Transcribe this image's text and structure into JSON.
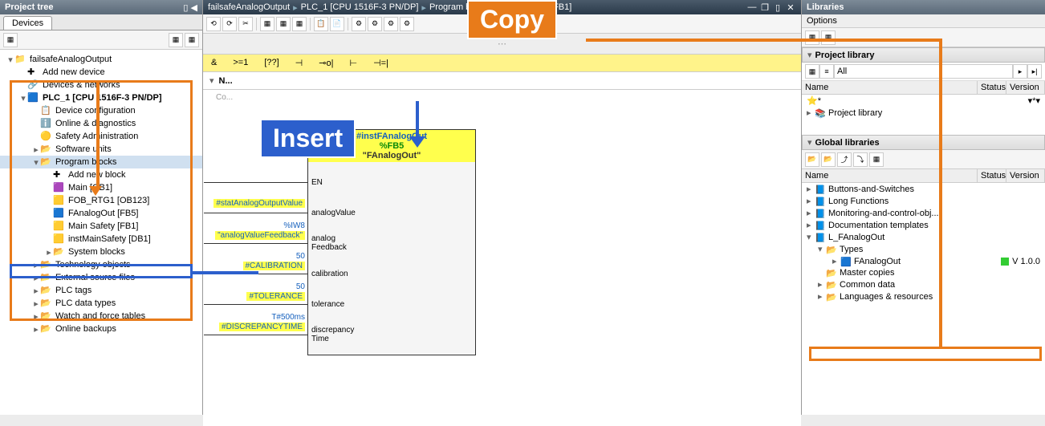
{
  "overlays": {
    "copy": "Copy",
    "insert": "Insert"
  },
  "left": {
    "header": "Project tree",
    "tab": "Devices",
    "tree": {
      "project": "failsafeAnalogOutput",
      "add_device": "Add new device",
      "devices_networks": "Devices & networks",
      "plc": "PLC_1 [CPU 1516F-3 PN/DP]",
      "device_config": "Device configuration",
      "online_diag": "Online & diagnostics",
      "safety_admin": "Safety Administration",
      "software_units": "Software units",
      "program_blocks": "Program blocks",
      "add_block": "Add new block",
      "main_ob1": "Main [OB1]",
      "fob_rtg1": "FOB_RTG1 [OB123]",
      "fanalogout": "FAnalogOut [FB5]",
      "main_safety": "Main Safety [FB1]",
      "inst_main_safety": "instMainSafety [DB1]",
      "system_blocks": "System blocks",
      "tech_objects": "Technology objects",
      "ext_source": "External source files",
      "plc_tags": "PLC tags",
      "plc_data_types": "PLC data types",
      "watch_tables": "Watch and force tables",
      "online_backups": "Online backups"
    }
  },
  "center": {
    "breadcrumb": [
      "failsafeAnalogOutput",
      "PLC_1 [CPU 1516F-3 PN/DP]",
      "Program blocks",
      "Main Safety [FB1]"
    ],
    "ladder_ops": [
      "&",
      ">=1",
      "[??]",
      "⊣",
      "⊸o|",
      "⊢",
      "⊣=|"
    ],
    "fb": {
      "inst": "#instFAnalogOut",
      "num": "%FB5",
      "name": "\"FAnalogOut\"",
      "pins": [
        {
          "label": "EN",
          "tag": "",
          "val": ""
        },
        {
          "label": "analogValue",
          "tag": "#statAnalogOutputValue",
          "val": ""
        },
        {
          "label": "analog\nFeedback",
          "tag": "\"analogValueFeedback\"",
          "val": "%IW8"
        },
        {
          "label": "calibration",
          "tag": "#CALIBRATION",
          "val": "50"
        },
        {
          "label": "tolerance",
          "tag": "#TOLERANCE",
          "val": "50"
        },
        {
          "label": "discrepancy\nTime",
          "tag": "#DISCREPANCYTIME",
          "val": "T#500ms"
        }
      ]
    }
  },
  "right": {
    "header": "Libraries",
    "options": "Options",
    "project_lib": "Project library",
    "filter_all": "All",
    "cols": {
      "name": "Name",
      "status": "Status",
      "version": "Version"
    },
    "project_lib_item": "Project library",
    "global_lib": "Global libraries",
    "global_items": {
      "buttons": "Buttons-and-Switches",
      "long_fn": "Long Functions",
      "monitoring": "Monitoring-and-control-obj...",
      "doc_tpl": "Documentation templates",
      "l_fanalog": "L_FAnalogOut",
      "types": "Types",
      "fanalogout": "FAnalogOut",
      "fanalogout_ver": "V 1.0.0",
      "master_copies": "Master copies",
      "common_data": "Common data",
      "lang_res": "Languages & resources"
    }
  }
}
